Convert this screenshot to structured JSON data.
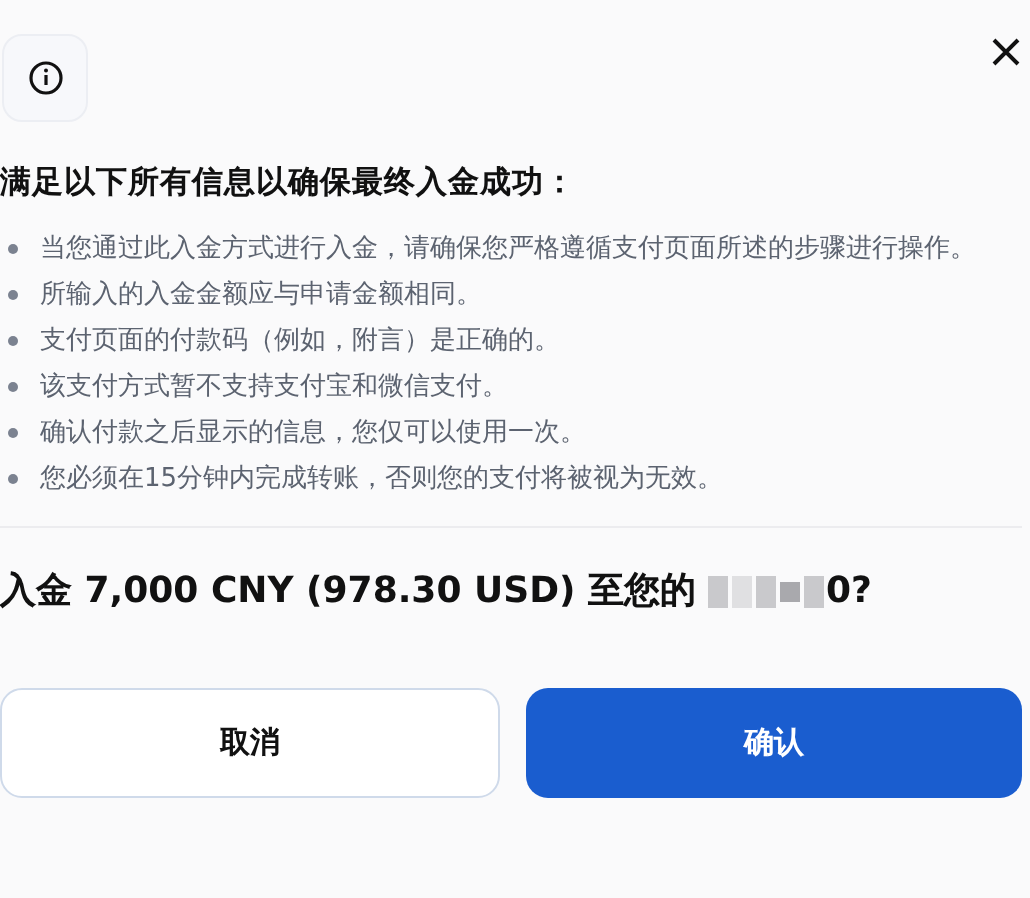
{
  "heading": "满足以下所有信息以确保最终入金成功：",
  "requirements": [
    "当您通过此入金方式进行入金，请确保您严格遵循支付页面所述的步骤进行操作。",
    "所输入的入金金额应与申请金额相同。",
    "支付页面的付款码（例如，附言）是正确的。",
    "该支付方式暂不支持支付宝和微信支付。",
    "确认付款之后显示的信息，您仅可以使用一次。",
    "您必须在15分钟内完成转账，否则您的支付将被视为无效。"
  ],
  "question": {
    "text": "入金 7,000 CNY (978.30 USD) 至您的",
    "account_end": "0?"
  },
  "buttons": [
    {
      "label": "取消",
      "kind": "secondary"
    },
    {
      "label": "确认",
      "kind": "primary"
    }
  ]
}
